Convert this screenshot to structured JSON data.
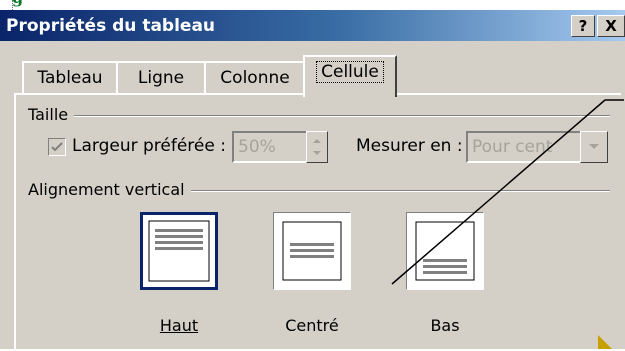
{
  "dialog": {
    "title": "Propriétés du tableau",
    "help_button": "?",
    "close_button": "X"
  },
  "tabs": [
    {
      "label": "Tableau",
      "active": false
    },
    {
      "label": "Ligne",
      "active": false
    },
    {
      "label": "Colonne",
      "active": false
    },
    {
      "label": "Cellule",
      "active": true
    }
  ],
  "size_group": {
    "label": "Taille",
    "preferred_width_label": "Largeur préférée :",
    "preferred_width_checked": true,
    "preferred_width_value": "50%",
    "measure_label": "Mesurer en :",
    "measure_value": "Pour cent"
  },
  "valign_group": {
    "label": "Alignement vertical",
    "options": [
      {
        "label": "Haut",
        "selected": true
      },
      {
        "label": "Centré",
        "selected": false
      },
      {
        "label": "Bas",
        "selected": false
      }
    ]
  },
  "colors": {
    "title_start": "#0a246a",
    "title_end": "#a6caf0",
    "face": "#d4d0c8",
    "selection": "#0a246a"
  }
}
